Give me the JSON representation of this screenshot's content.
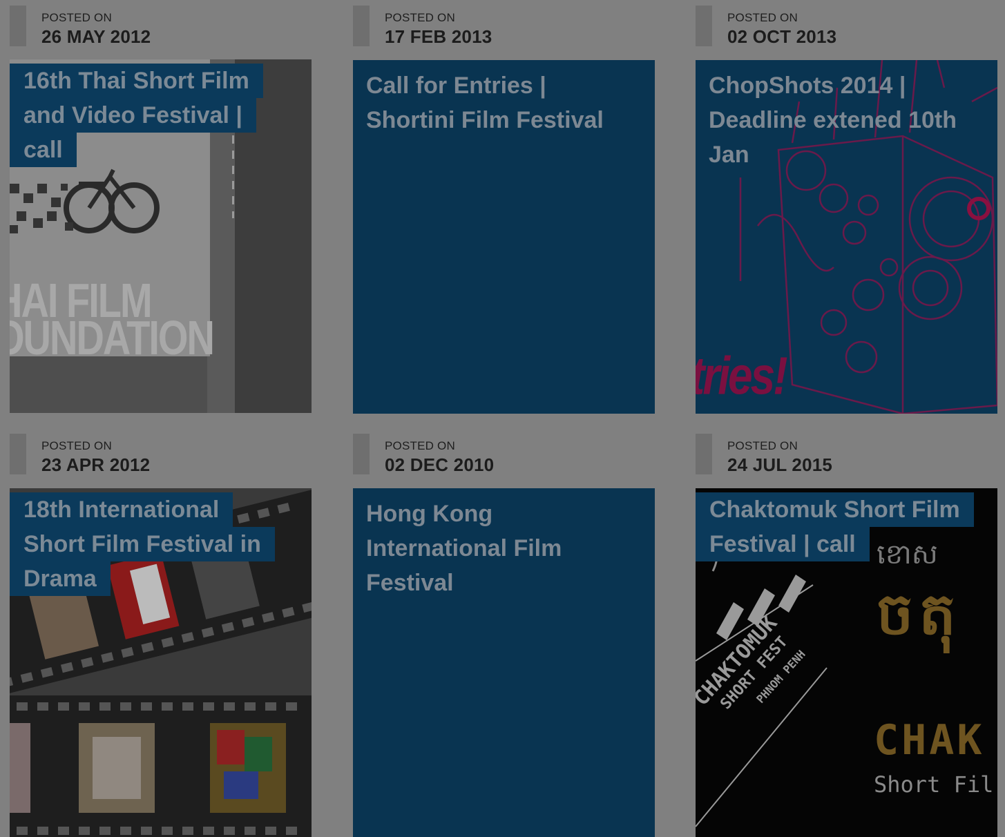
{
  "posts": [
    {
      "posted_label": "POSTED ON",
      "date": "26 MAY 2012",
      "title_lines": [
        "16th Thai Short Film",
        "and Video Festival |",
        "call"
      ],
      "thumbnail": "thai-film-foundation-poster",
      "thumb_text": [
        "HAI FILM",
        "OUNDATION"
      ]
    },
    {
      "posted_label": "POSTED ON",
      "date": "17 FEB 2013",
      "title": "Call for Entries | Shortini Film Festival",
      "thumbnail": "none"
    },
    {
      "posted_label": "POSTED ON",
      "date": "02 OCT 2013",
      "title_lines": [
        "ChopShots 2014 |",
        "Deadline extened 10th",
        "Jan"
      ],
      "thumbnail": "projector-illustration",
      "thumb_text": [
        "tries!"
      ]
    },
    {
      "posted_label": "POSTED ON",
      "date": "23 APR 2012",
      "title_lines": [
        "18th International",
        "Short Film Festival in",
        "Drama"
      ],
      "thumbnail": "film-strips"
    },
    {
      "posted_label": "POSTED ON",
      "date": "02 DEC 2010",
      "title": "Hong Kong International Film Festival",
      "thumbnail": "none"
    },
    {
      "posted_label": "POSTED ON",
      "date": "24 JUL 2015",
      "title_lines": [
        "Chaktomuk Short Film",
        "Festival | call"
      ],
      "thumbnail": "chaktomuk-clapperboard",
      "thumb_text": [
        "CHAK",
        "Short Fil",
        "CHAKTOMUK",
        "SHORT FEST",
        "PHNOM PENH"
      ]
    }
  ],
  "colors": {
    "page_overlay": "#808080",
    "card_plain": "#093451",
    "title_bg": "#0b3a5b",
    "title_text": "#7c8a96"
  }
}
